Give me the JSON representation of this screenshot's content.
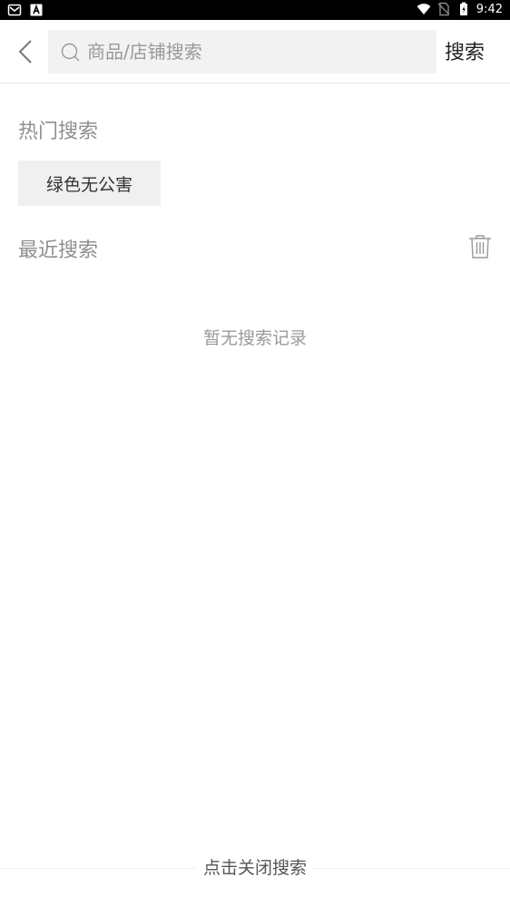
{
  "status_bar": {
    "time": "9:42",
    "left_icons": [
      "mail-icon",
      "a-badge-icon"
    ],
    "right_icons": [
      "wifi-icon",
      "no-sim-icon",
      "battery-icon"
    ]
  },
  "header": {
    "back_icon": "chevron-left-icon",
    "search": {
      "placeholder": "商品/店铺搜索",
      "value": "",
      "icon": "search-icon"
    },
    "search_button_label": "搜索"
  },
  "hot_search": {
    "title": "热门搜索",
    "tags": [
      "绿色无公害"
    ]
  },
  "recent_search": {
    "title": "最近搜索",
    "delete_icon": "trash-icon",
    "empty_text": "暂无搜索记录"
  },
  "footer": {
    "close_label": "点击关闭搜索"
  },
  "colors": {
    "section_title": "#8f8f8f",
    "tag_bg": "#f0f0f0",
    "search_bg": "#f2f2f2",
    "status_bg": "#000000"
  }
}
